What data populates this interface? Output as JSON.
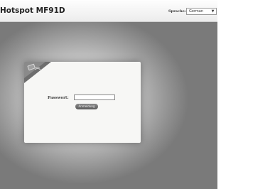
{
  "header": {
    "title": "Hotspot MF91D",
    "language_label": "Sprache:",
    "language_selected": "German"
  },
  "login": {
    "password_label": "Passwort:",
    "password_value": "",
    "login_button": "Anmeldung"
  }
}
